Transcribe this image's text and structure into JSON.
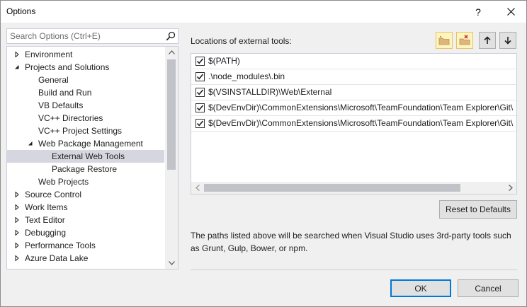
{
  "window": {
    "title": "Options",
    "help_label": "?"
  },
  "search": {
    "placeholder": "Search Options (Ctrl+E)"
  },
  "tree": {
    "items": [
      {
        "label": "Environment",
        "arrow": "right",
        "level": 0
      },
      {
        "label": "Projects and Solutions",
        "arrow": "down",
        "level": 0
      },
      {
        "label": "General",
        "arrow": "",
        "level": 1
      },
      {
        "label": "Build and Run",
        "arrow": "",
        "level": 1
      },
      {
        "label": "VB Defaults",
        "arrow": "",
        "level": 1
      },
      {
        "label": "VC++ Directories",
        "arrow": "",
        "level": 1
      },
      {
        "label": "VC++ Project Settings",
        "arrow": "",
        "level": 1
      },
      {
        "label": "Web Package Management",
        "arrow": "down",
        "level": 1
      },
      {
        "label": "External Web Tools",
        "arrow": "",
        "level": 2,
        "selected": true
      },
      {
        "label": "Package Restore",
        "arrow": "",
        "level": 2
      },
      {
        "label": "Web Projects",
        "arrow": "",
        "level": 1
      },
      {
        "label": "Source Control",
        "arrow": "right",
        "level": 0
      },
      {
        "label": "Work Items",
        "arrow": "right",
        "level": 0
      },
      {
        "label": "Text Editor",
        "arrow": "right",
        "level": 0
      },
      {
        "label": "Debugging",
        "arrow": "right",
        "level": 0
      },
      {
        "label": "Performance Tools",
        "arrow": "right",
        "level": 0
      },
      {
        "label": "Azure Data Lake",
        "arrow": "right",
        "level": 0
      }
    ]
  },
  "locations": {
    "label": "Locations of external tools:",
    "toolbar": {
      "add_icon": "new-folder-icon",
      "remove_icon": "delete-folder-icon",
      "up_icon": "arrow-up-icon",
      "down_icon": "arrow-down-icon"
    },
    "paths": [
      {
        "path": "$(PATH)",
        "checked": true
      },
      {
        "path": ".\\node_modules\\.bin",
        "checked": true
      },
      {
        "path": "$(VSINSTALLDIR)\\Web\\External",
        "checked": true
      },
      {
        "path": "$(DevEnvDir)\\CommonExtensions\\Microsoft\\TeamFoundation\\Team Explorer\\Git\\",
        "checked": true
      },
      {
        "path": "$(DevEnvDir)\\CommonExtensions\\Microsoft\\TeamFoundation\\Team Explorer\\Git\\",
        "checked": true
      }
    ]
  },
  "buttons": {
    "reset": "Reset to Defaults",
    "ok": "OK",
    "cancel": "Cancel"
  },
  "description": "The paths listed above will be searched when Visual Studio uses 3rd-party tools such as Grunt, Gulp, Bower, or npm.",
  "colors": {
    "selection": "#d6d6e0",
    "accent": "#0078d7"
  }
}
